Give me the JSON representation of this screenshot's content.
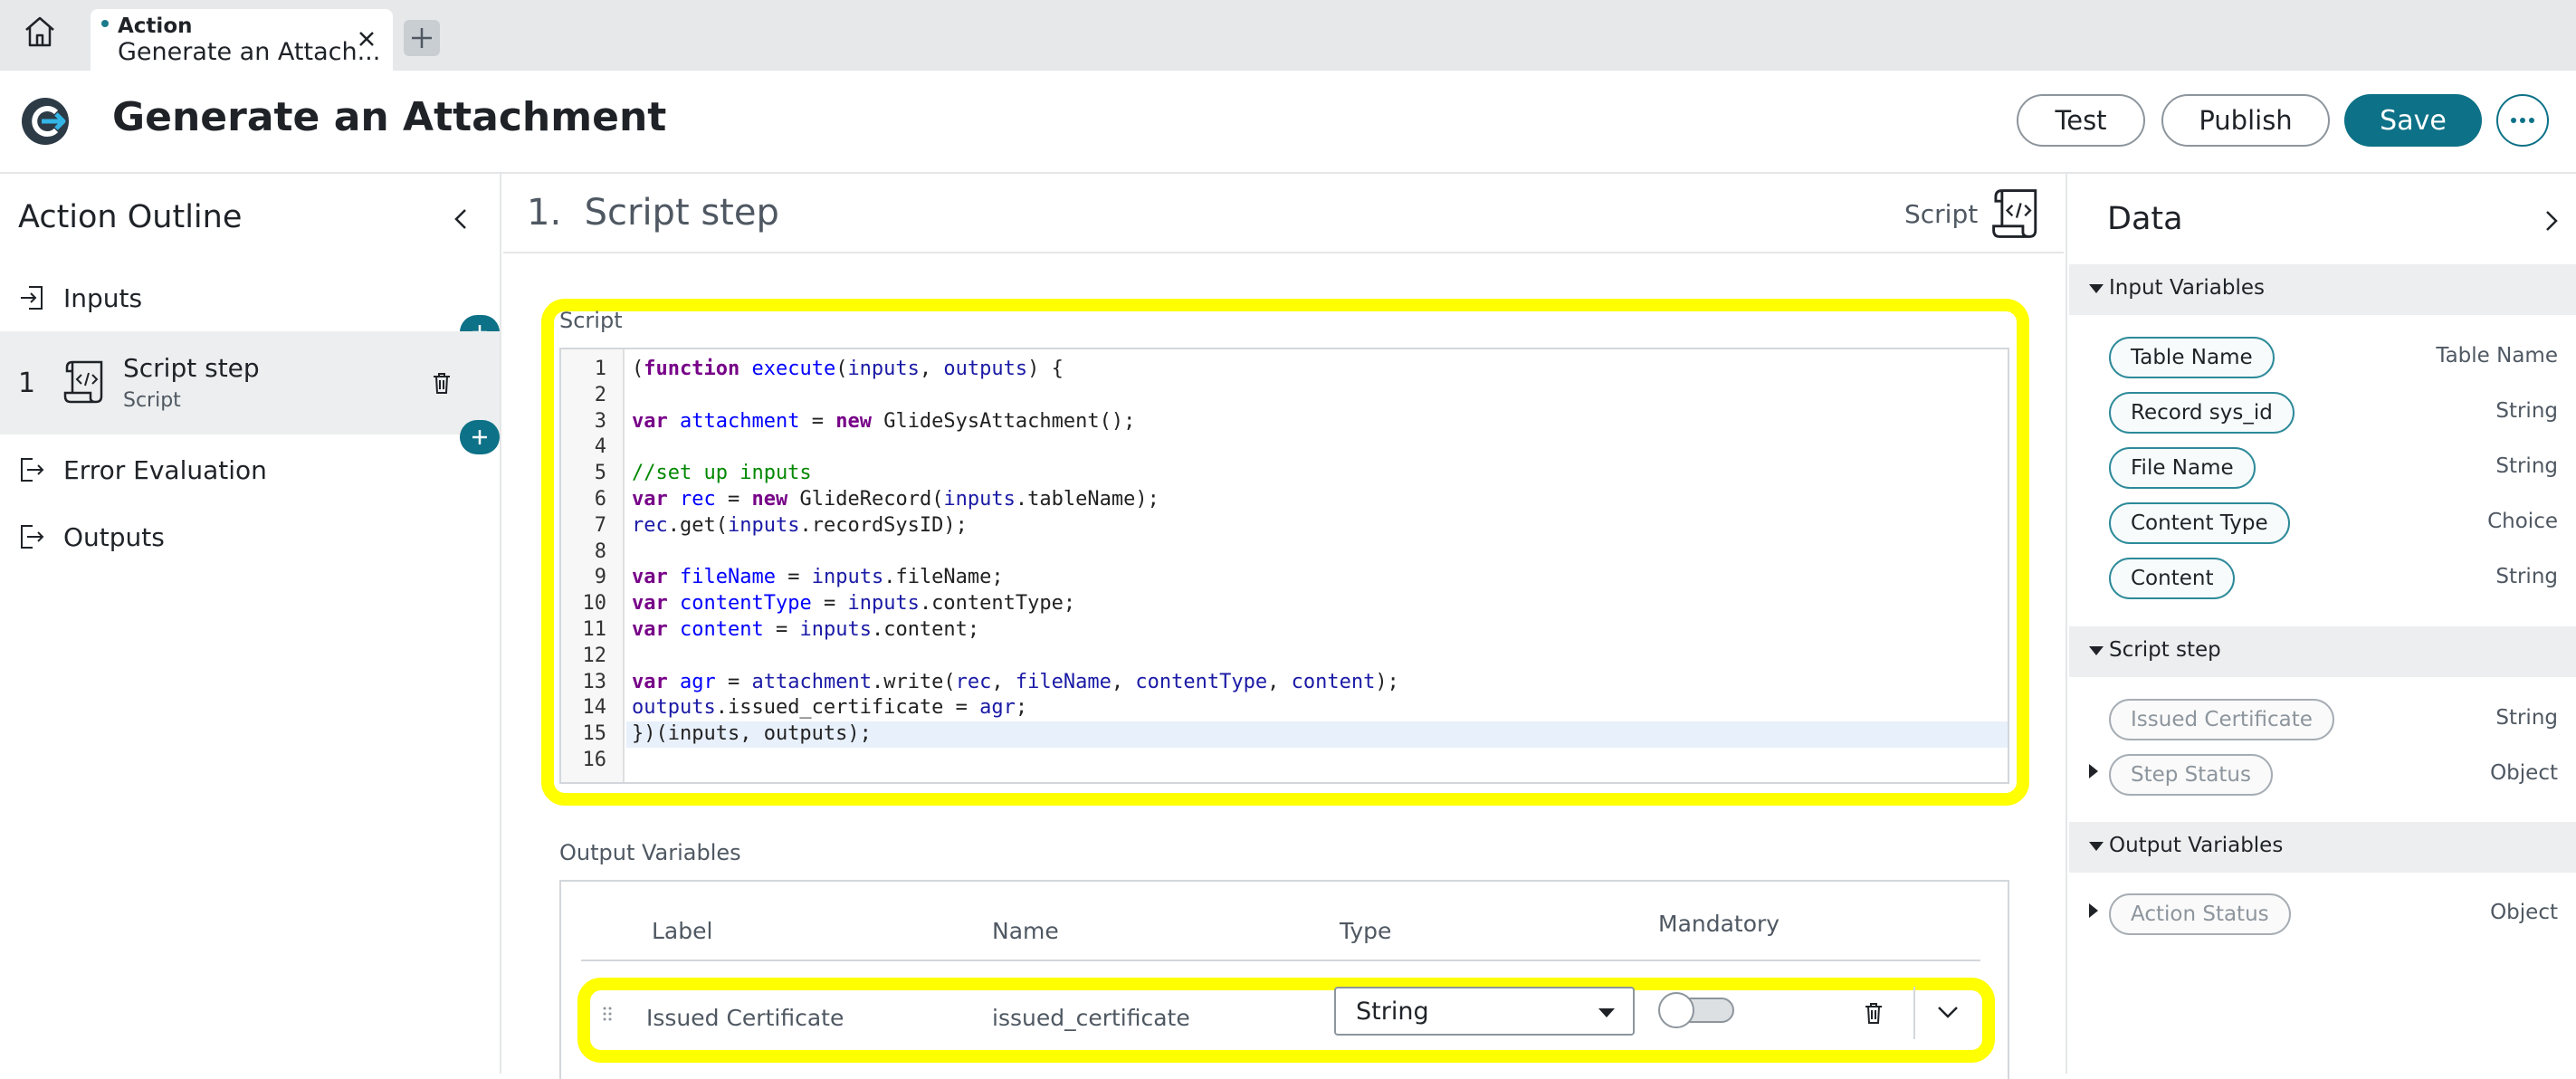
{
  "tab": {
    "type_label": "Action",
    "title": "Generate an Attach...",
    "dot_color": "#1c7a8c"
  },
  "header": {
    "title": "Generate an Attachment",
    "test_label": "Test",
    "publish_label": "Publish",
    "save_label": "Save",
    "more_icon": "more-horizontal-icon",
    "accent": "#0d7187"
  },
  "outline": {
    "title": "Action Outline",
    "inputs_label": "Inputs",
    "step": {
      "number": "1",
      "name": "Script step",
      "type": "Script"
    },
    "error_label": "Error Evaluation",
    "outputs_label": "Outputs"
  },
  "main": {
    "step_number": "1.",
    "step_title": "Script step",
    "step_type": "Script",
    "script_label": "Script",
    "code_lines": [
      "1",
      "2",
      "3",
      "4",
      "5",
      "6",
      "7",
      "8",
      "9",
      "10",
      "11",
      "12",
      "13",
      "14",
      "15",
      "16"
    ],
    "output_label": "Output Variables",
    "columns": {
      "label": "Label",
      "name": "Name",
      "type": "Type",
      "mandatory": "Mandatory"
    },
    "row": {
      "label": "Issued Certificate",
      "name": "issued_certificate",
      "type": "String",
      "mandatory": false
    },
    "highlight_color": "#ffff00"
  },
  "data_panel": {
    "title": "Data",
    "sections": {
      "input_variables": "Input Variables",
      "script_step": "Script step",
      "output_variables": "Output Variables"
    },
    "inputs": [
      {
        "name": "Table Name",
        "type": "Table Name"
      },
      {
        "name": "Record sys_id",
        "type": "String"
      },
      {
        "name": "File Name",
        "type": "String"
      },
      {
        "name": "Content Type",
        "type": "Choice"
      },
      {
        "name": "Content",
        "type": "String"
      }
    ],
    "script_outputs": [
      {
        "name": "Issued Certificate",
        "type": "String"
      },
      {
        "name": "Step Status",
        "type": "Object"
      }
    ],
    "outputs": [
      {
        "name": "Action Status",
        "type": "Object"
      }
    ]
  }
}
